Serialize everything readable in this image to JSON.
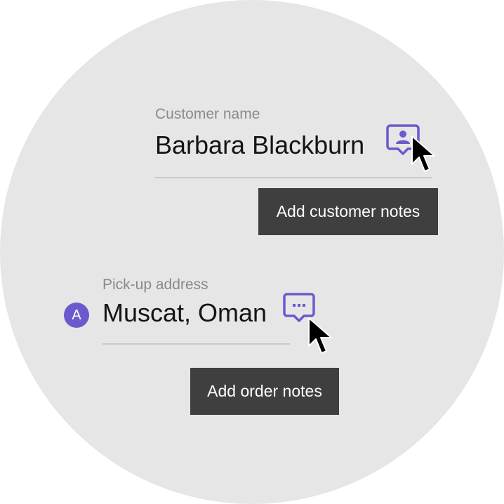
{
  "colors": {
    "accent": "#6a5acd",
    "tooltip_bg": "#3f3f3f",
    "background_circle": "#e6e6e6",
    "label_text": "#8a8a8a",
    "value_text": "#141414"
  },
  "customer": {
    "label": "Customer name",
    "value": "Barbara Blackburn",
    "notes_icon": "contact-chat-icon",
    "tooltip": "Add customer notes"
  },
  "pickup": {
    "badge_letter": "A",
    "label": "Pick-up address",
    "value": "Muscat, Oman",
    "notes_icon": "chat-dots-icon",
    "tooltip": "Add order notes"
  }
}
